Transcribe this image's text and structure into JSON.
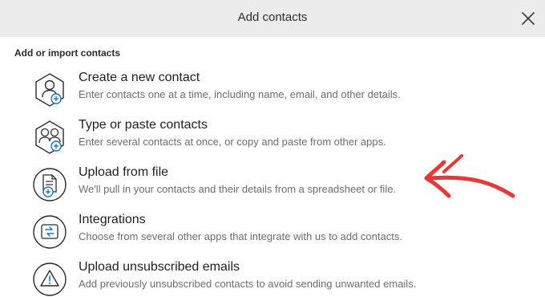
{
  "dialog": {
    "title": "Add contacts",
    "close_icon": "close-icon"
  },
  "section_label": "Add or import contacts",
  "options": [
    {
      "title": "Create a new contact",
      "description": "Enter contacts one at a time, including name, email, and other details.",
      "icon": "person-add-icon"
    },
    {
      "title": "Type or paste contacts",
      "description": "Enter several contacts at once, or copy and paste from other apps.",
      "icon": "people-add-icon"
    },
    {
      "title": "Upload from file",
      "description": "We'll pull in your contacts and their details from a spreadsheet or file.",
      "icon": "file-upload-icon"
    },
    {
      "title": "Integrations",
      "description": "Choose from several other apps that integrate with us to add contacts.",
      "icon": "integrations-icon"
    },
    {
      "title": "Upload unsubscribed emails",
      "description": "Add previously unsubscribed contacts to avoid sending unwanted emails.",
      "icon": "warning-icon"
    }
  ],
  "annotation": {
    "color": "#e53935",
    "icon": "red-arrow-annotation"
  },
  "colors": {
    "header_bg": "#ececed",
    "icon_accent": "#1e73be",
    "icon_stroke": "#2b2b2b"
  }
}
